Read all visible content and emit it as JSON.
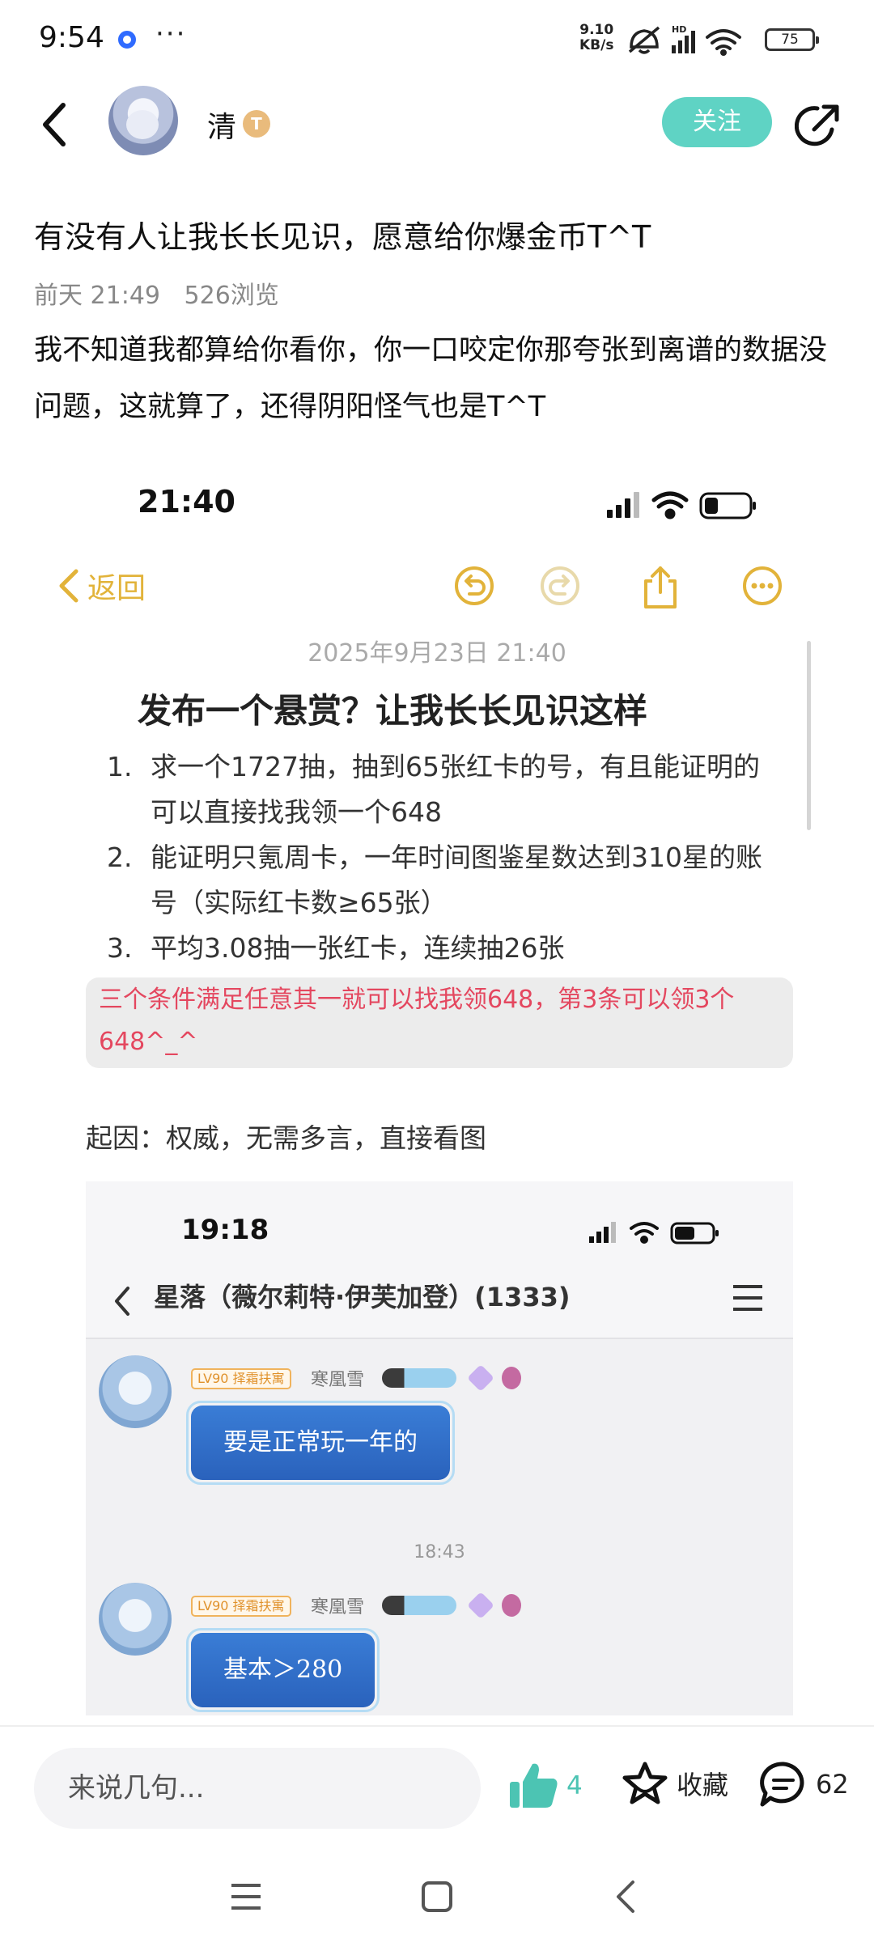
{
  "status_bar": {
    "time": "9:54",
    "net_speed_value": "9.10",
    "net_speed_unit": "KB/s",
    "hd_label": "HD",
    "battery": "75"
  },
  "header": {
    "author_name": "清",
    "level_badge": "T",
    "follow_label": "关注"
  },
  "post": {
    "title": "有没有人让我长长见识，愿意给你爆金币T^T",
    "time": "前天 21:49",
    "views": "526浏览",
    "body": "我不知道我都算给你看你，你一口咬定你那夸张到离谱的数据没问题，这就算了，还得阴阳怪气也是T^T"
  },
  "screenshot": {
    "time": "21:40",
    "back_label": "返回",
    "date": "2025年9月23日 21:40",
    "heading": "发布一个悬赏？让我长长见识这样",
    "items": [
      {
        "num": "1.",
        "text": "求一个1727抽，抽到65张红卡的号，有且能证明的可以直接找我领一个648"
      },
      {
        "num": "2.",
        "text": "能证明只氪周卡，一年时间图鉴星数达到310星的账号（实际红卡数≥65张）"
      },
      {
        "num": "3.",
        "text": "平均3.08抽一张红卡，连续抽26张"
      }
    ],
    "highlight": "三个条件满足任意其一就可以找我领648，第3条可以领3个648^_^",
    "reason": "起因：权威，无需多言，直接看图",
    "chat": {
      "time": "19:18",
      "title": "星落（薇尔莉特·伊芙加登）(1333)",
      "messages": [
        {
          "badge": "LV90 择霜扶寓",
          "nick": "寒凰雪",
          "text": "要是正常玩一年的"
        },
        {
          "badge": "LV90 择霜扶寓",
          "nick": "寒凰雪",
          "text": "基本＞280"
        }
      ],
      "timestamp": "18:43"
    }
  },
  "bottom_bar": {
    "comment_placeholder": "来说几句...",
    "like_count": "4",
    "favorite_label": "收藏",
    "comment_count": "62"
  },
  "colors": {
    "accent": "#5fd3c4",
    "highlight_text": "#e4475f",
    "notes_yellow": "#e2b33a"
  }
}
